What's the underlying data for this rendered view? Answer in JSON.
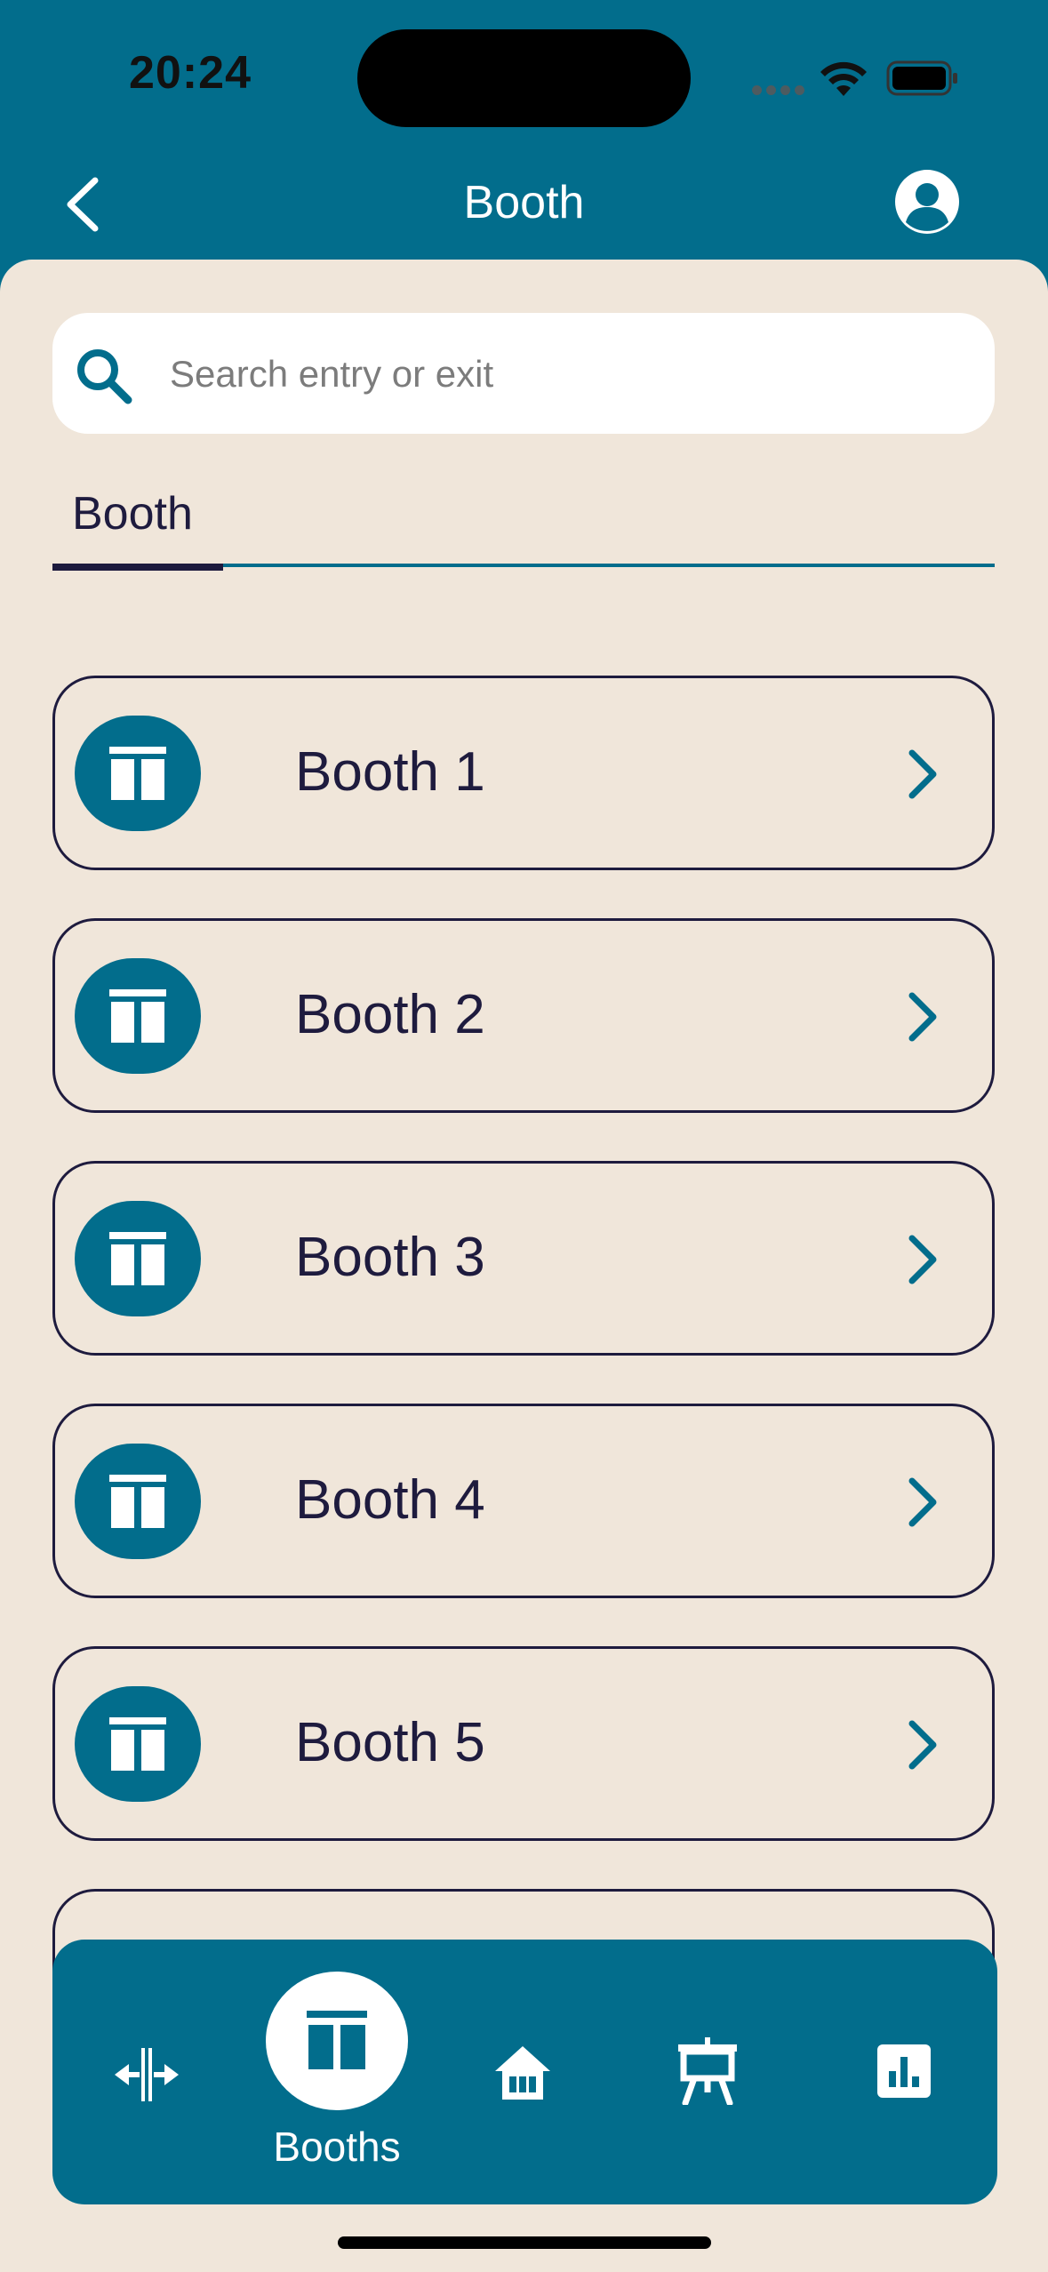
{
  "status_bar": {
    "time": "20:24"
  },
  "header": {
    "title": "Booth"
  },
  "search": {
    "placeholder": "Search entry or exit",
    "value": ""
  },
  "tabs": [
    {
      "label": "Booth",
      "active": true
    }
  ],
  "booths": [
    {
      "label": "Booth 1"
    },
    {
      "label": "Booth 2"
    },
    {
      "label": "Booth 3"
    },
    {
      "label": "Booth 4"
    },
    {
      "label": "Booth 5"
    },
    {
      "label": ""
    }
  ],
  "bottom_nav": {
    "items": [
      {
        "icon": "entry-exit-icon"
      },
      {
        "icon": "booth-icon",
        "label": "Booths",
        "active": true
      },
      {
        "icon": "home-icon"
      },
      {
        "icon": "stage-icon"
      },
      {
        "icon": "stats-icon"
      }
    ]
  },
  "colors": {
    "primary": "#026d8c",
    "background": "#f0e6da",
    "text": "#1e1b3e"
  }
}
